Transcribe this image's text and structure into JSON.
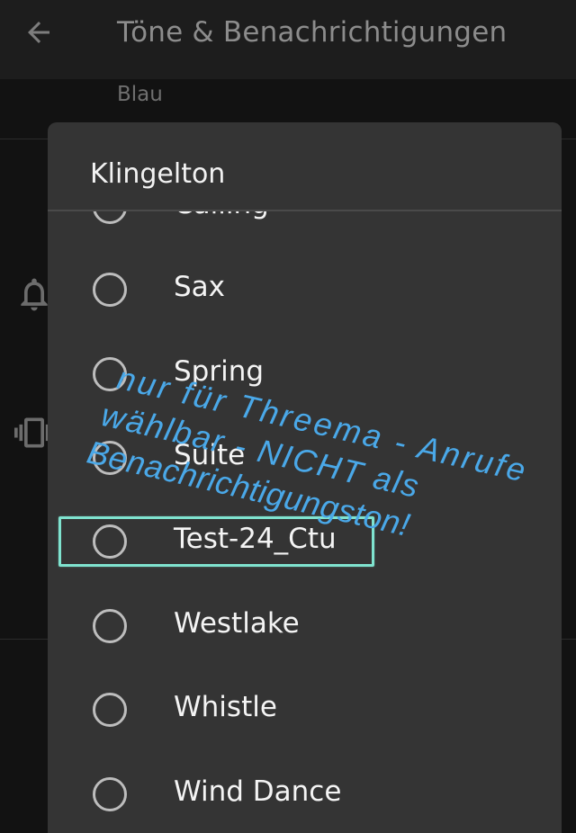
{
  "appbar": {
    "title": "Töne & Benachrichtigungen",
    "back_icon": "arrow-left-icon"
  },
  "background": {
    "subtitle": "Blau",
    "icons": [
      "bell-icon",
      "vibrate-icon"
    ]
  },
  "dialog": {
    "title": "Klingelton",
    "options": [
      {
        "label": "Calling",
        "selected": false
      },
      {
        "label": "Sax",
        "selected": false
      },
      {
        "label": "Spring",
        "selected": false
      },
      {
        "label": "Suite",
        "selected": false
      },
      {
        "label": "Test-24_Ctu",
        "selected": false
      },
      {
        "label": "Westlake",
        "selected": false
      },
      {
        "label": "Whistle",
        "selected": false
      },
      {
        "label": "Wind Dance",
        "selected": false
      }
    ]
  },
  "annotation": {
    "line1": "nur  für  Threema  -  Anrufe",
    "line2": "wählbar  -  NICHT  als",
    "line3": "Benachrichtigungston!",
    "text_color": "#4aa8e8",
    "highlight_color": "#7fe3cf"
  },
  "colors": {
    "dialog_bg": "#343434",
    "app_bg": "#121212",
    "appbar_bg": "#1d1d1d"
  }
}
